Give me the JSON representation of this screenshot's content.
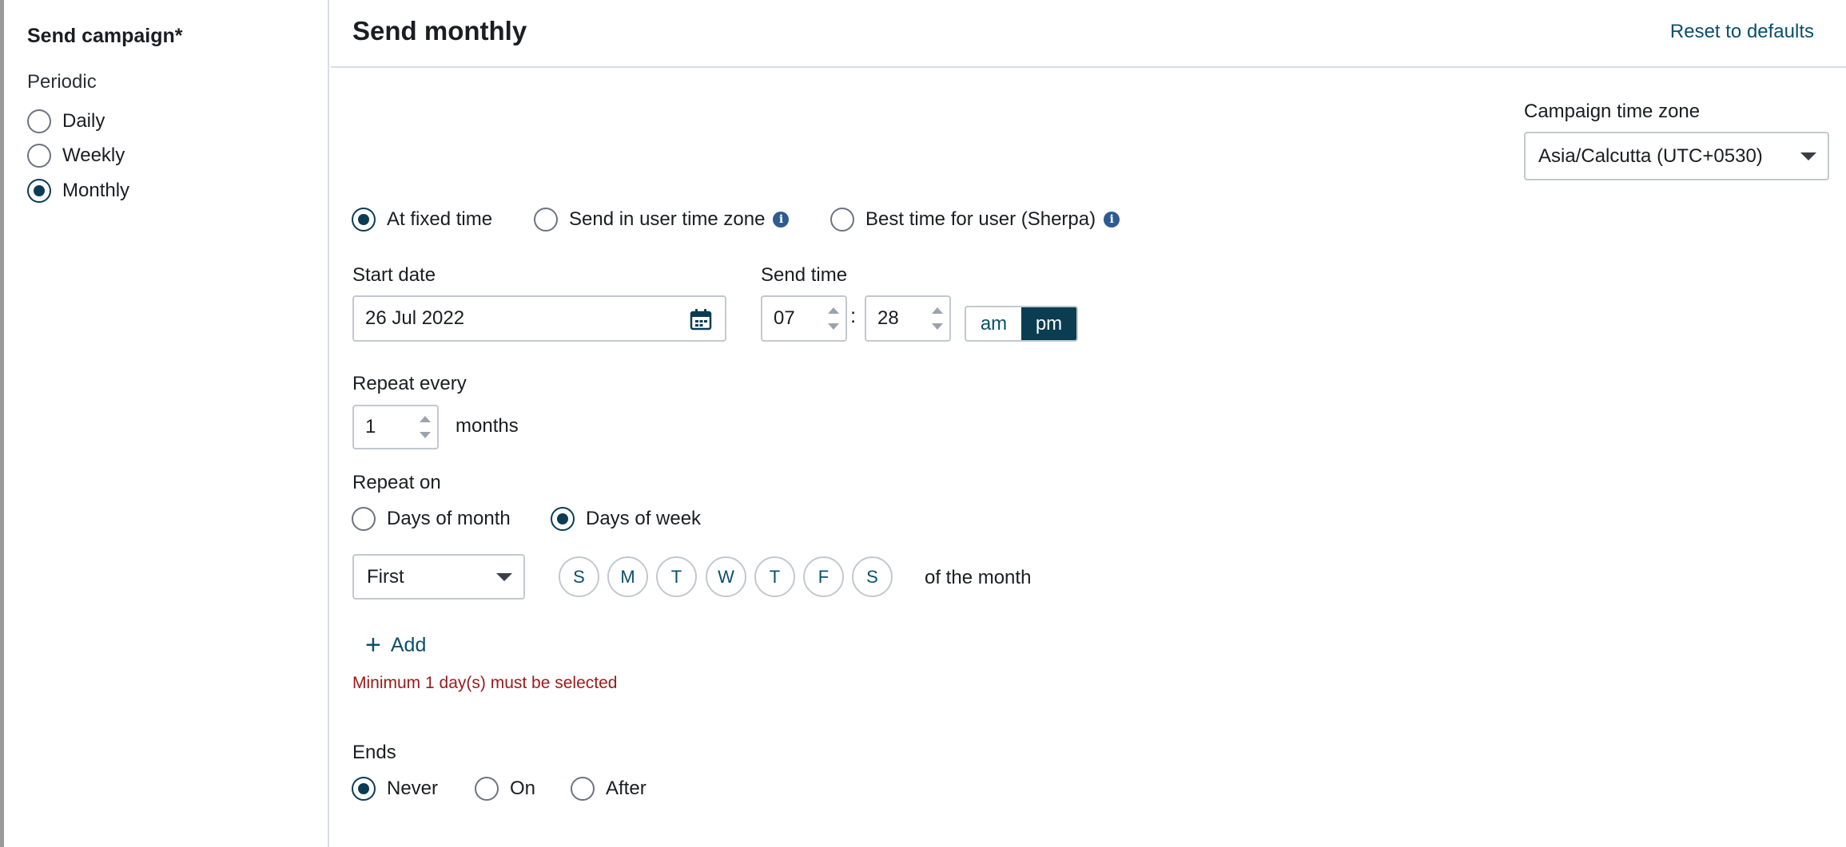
{
  "sidebar": {
    "title": "Send campaign*",
    "subtitle": "Periodic",
    "options": [
      {
        "label": "Daily",
        "checked": false
      },
      {
        "label": "Weekly",
        "checked": false
      },
      {
        "label": "Monthly",
        "checked": true
      }
    ]
  },
  "header": {
    "title": "Send monthly",
    "reset_label": "Reset to defaults"
  },
  "timezone": {
    "label": "Campaign time zone",
    "value": "Asia/Calcutta (UTC+0530)"
  },
  "time_mode": {
    "options": [
      {
        "label": "At fixed time",
        "checked": true,
        "info": false
      },
      {
        "label": "Send in user time zone",
        "checked": false,
        "info": true
      },
      {
        "label": "Best time for user (Sherpa)",
        "checked": false,
        "info": true
      }
    ]
  },
  "start_date": {
    "label": "Start date",
    "value": "26 Jul 2022"
  },
  "send_time": {
    "label": "Send time",
    "hour": "07",
    "minute": "28",
    "separator": ":",
    "am_label": "am",
    "pm_label": "pm",
    "selected": "pm"
  },
  "repeat_every": {
    "label": "Repeat every",
    "value": "1",
    "unit": "months"
  },
  "repeat_on": {
    "label": "Repeat on",
    "options": [
      {
        "label": "Days of month",
        "checked": false
      },
      {
        "label": "Days of week",
        "checked": true
      }
    ],
    "ordinal": "First",
    "days": [
      "S",
      "M",
      "T",
      "W",
      "T",
      "F",
      "S"
    ],
    "suffix": "of the month",
    "add_label": "Add",
    "error": "Minimum 1 day(s) must be selected"
  },
  "ends": {
    "label": "Ends",
    "options": [
      {
        "label": "Never",
        "checked": true
      },
      {
        "label": "On",
        "checked": false
      },
      {
        "label": "After",
        "checked": false
      }
    ]
  },
  "colors": {
    "accent": "#0b3d52",
    "link": "#0b4f6c",
    "error": "#9b1a1a",
    "info": "#2f5b8f"
  }
}
